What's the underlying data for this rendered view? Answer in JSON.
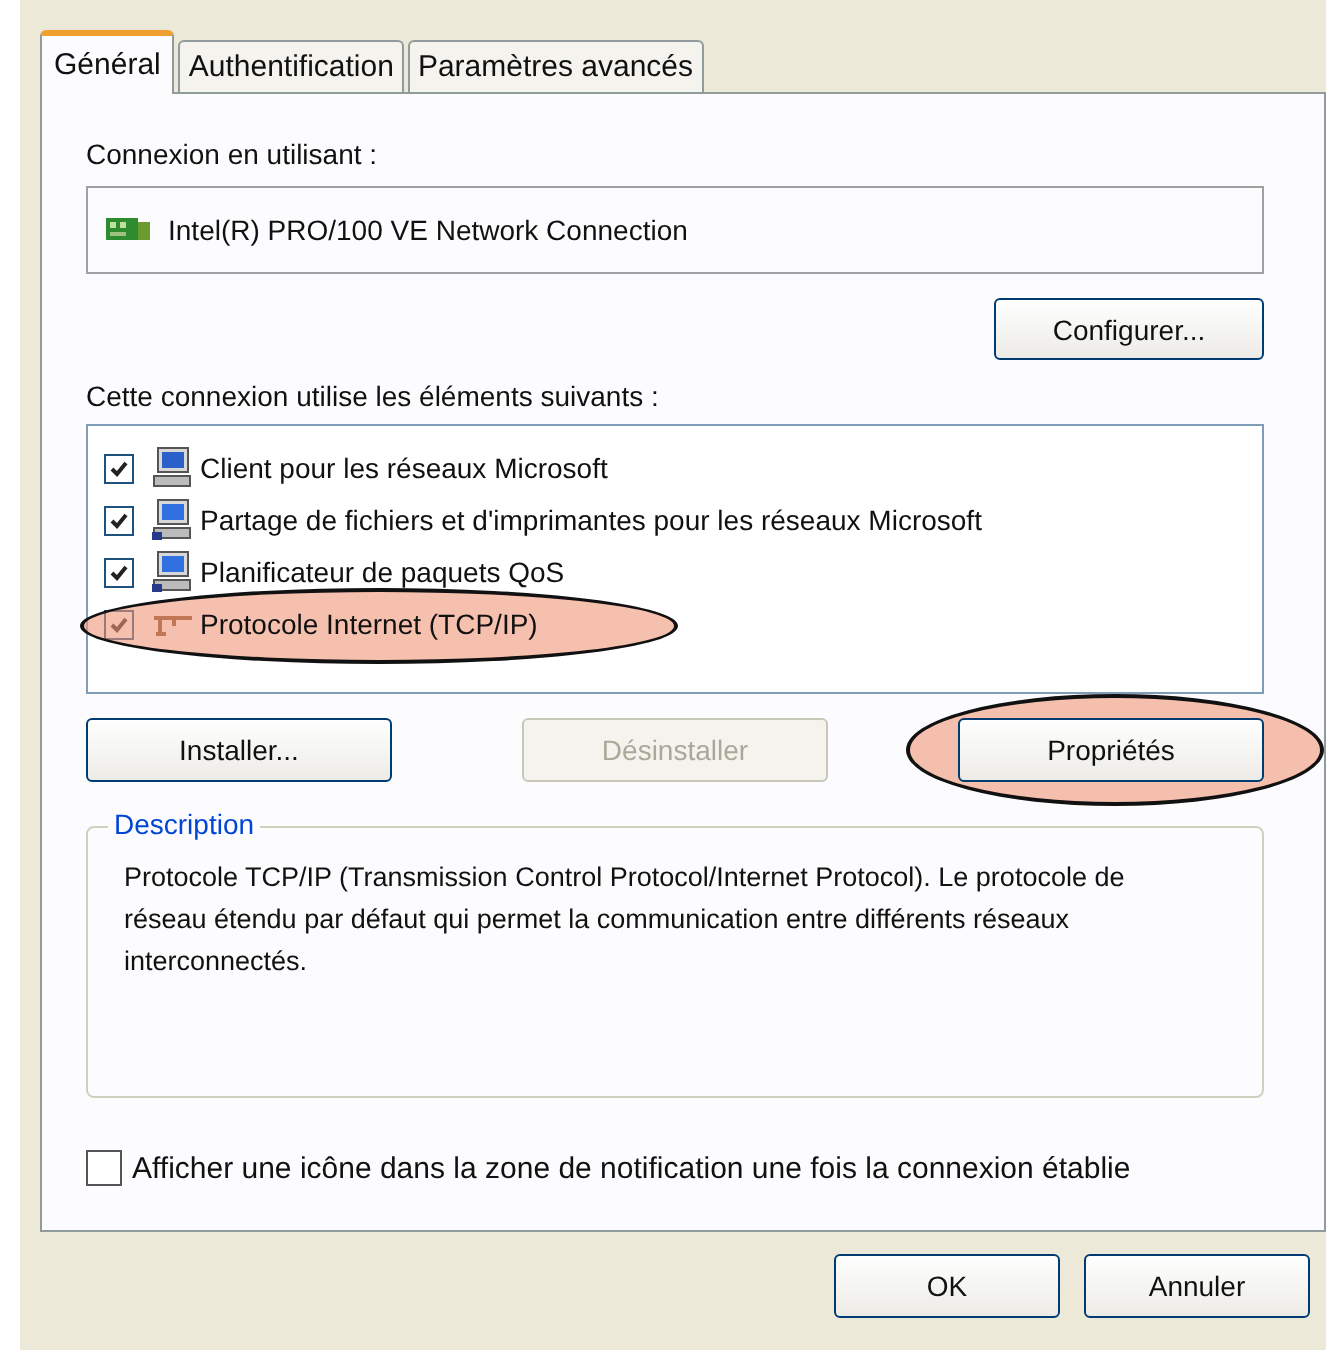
{
  "tabs": [
    {
      "label": "Général",
      "selected": true
    },
    {
      "label": "Authentification",
      "selected": false
    },
    {
      "label": "Paramètres avancés",
      "selected": false
    }
  ],
  "connection": {
    "label": "Connexion en utilisant :",
    "adapter": "Intel(R) PRO/100 VE Network Connection",
    "configure_button": "Configurer..."
  },
  "components": {
    "label": "Cette connexion utilise les éléments suivants :",
    "items": [
      {
        "label": "Client pour les réseaux Microsoft",
        "checked": true,
        "kind": "client",
        "circled": false
      },
      {
        "label": "Partage de fichiers et d'imprimantes pour les réseaux Microsoft",
        "checked": true,
        "kind": "service",
        "circled": false
      },
      {
        "label": "Planificateur de paquets QoS",
        "checked": true,
        "kind": "service",
        "circled": false
      },
      {
        "label": "Protocole Internet (TCP/IP)",
        "checked": true,
        "kind": "protocol",
        "circled": true
      }
    ]
  },
  "buttons": [
    {
      "label": "Installer...",
      "disabled": false,
      "circled": false
    },
    {
      "label": "Désinstaller",
      "disabled": true,
      "circled": false
    },
    {
      "label": "Propriétés",
      "disabled": false,
      "circled": true
    }
  ],
  "description": {
    "title": "Description",
    "text": "Protocole TCP/IP (Transmission Control Protocol/Internet Protocol). Le protocole de réseau étendu par défaut qui permet la communication entre différents réseaux interconnectés."
  },
  "notify": {
    "label": "Afficher une icône dans la zone de notification une fois la connexion établie",
    "checked": false
  },
  "dialog_buttons": [
    "OK",
    "Annuler"
  ]
}
